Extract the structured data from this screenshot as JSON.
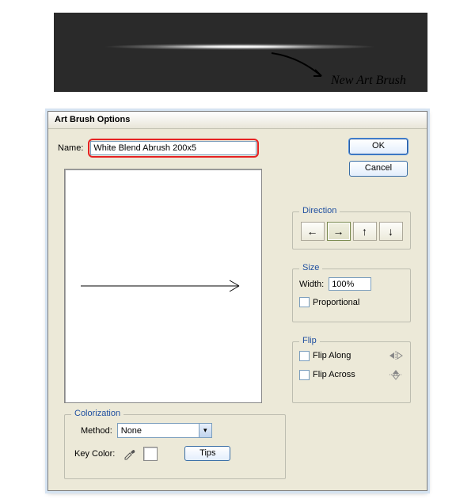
{
  "annotation": {
    "text": "New Art Brush"
  },
  "dialog": {
    "title": "Art Brush Options",
    "name_label": "Name:",
    "name_value": "White Blend Abrush 200x5",
    "buttons": {
      "ok": "OK",
      "cancel": "Cancel"
    },
    "direction": {
      "title": "Direction",
      "options": [
        "←",
        "→",
        "↑",
        "↓"
      ],
      "selected_index": 1
    },
    "size": {
      "title": "Size",
      "width_label": "Width:",
      "width_value": "100%",
      "proportional_label": "Proportional",
      "proportional_checked": false
    },
    "flip": {
      "title": "Flip",
      "along_label": "Flip Along",
      "along_checked": false,
      "across_label": "Flip Across",
      "across_checked": false
    },
    "colorization": {
      "title": "Colorization",
      "method_label": "Method:",
      "method_value": "None",
      "keycolor_label": "Key Color:",
      "tips_label": "Tips"
    }
  }
}
